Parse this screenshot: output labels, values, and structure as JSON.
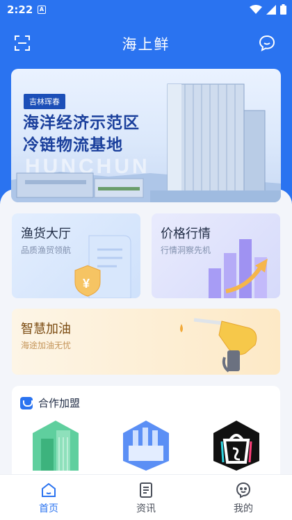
{
  "status_bar": {
    "time": "2:22",
    "notification_glyph": "A",
    "icons": [
      "wifi-icon",
      "signal-icon",
      "battery-icon"
    ]
  },
  "header": {
    "title": "海上鲜",
    "left_icon": "scan-icon",
    "right_icon": "message-icon"
  },
  "banner": {
    "tag": "吉林珲春",
    "line1": "海洋经济示范区",
    "line2": "冷链物流基地",
    "watermark": "HUNCHUN"
  },
  "cards": {
    "fish_hall": {
      "title": "渔货大厅",
      "subtitle": "品质渔贸领航"
    },
    "price": {
      "title": "价格行情",
      "subtitle": "行情洞察先机"
    },
    "fuel": {
      "title": "智慧加油",
      "subtitle": "海途加油无忧"
    }
  },
  "cooperation": {
    "title": "合作加盟",
    "partners": [
      "building-logo",
      "factory-logo",
      "bag-logo"
    ]
  },
  "tabbar": {
    "items": [
      {
        "label": "首页",
        "icon": "home-icon",
        "active": true
      },
      {
        "label": "资讯",
        "icon": "news-icon",
        "active": false
      },
      {
        "label": "我的",
        "icon": "profile-icon",
        "active": false
      }
    ]
  },
  "colors": {
    "primary": "#2a73f0",
    "background": "#f3f5fa"
  }
}
